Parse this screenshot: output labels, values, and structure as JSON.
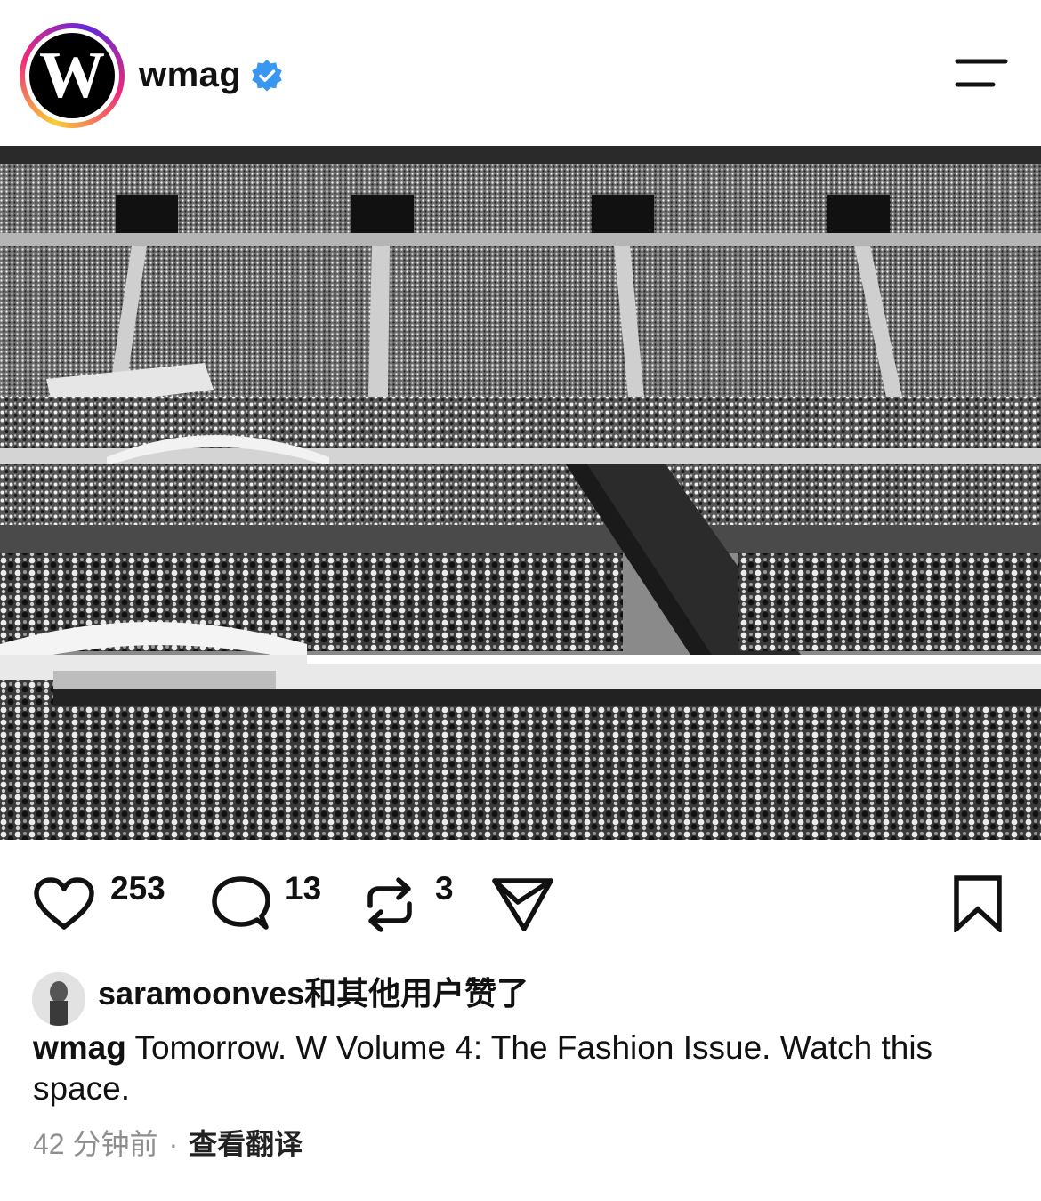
{
  "header": {
    "avatar_letter": "W",
    "username": "wmag",
    "verified_color": "#3897f0"
  },
  "post": {
    "image_alt": "Black and white photo of a packed stadium crowd with stage runways",
    "image_style": "black-and-white"
  },
  "actions": {
    "like_count": "253",
    "comment_count": "13",
    "repost_count": "3"
  },
  "likes": {
    "username": "saramoonves",
    "suffix": "和其他用户赞了"
  },
  "caption": {
    "username": "wmag",
    "text": " Tomorrow. W Volume 4: The Fashion Issue. Watch this space."
  },
  "meta": {
    "time": "42 分钟前",
    "separator": "·",
    "translate_label": "查看翻译"
  },
  "icons": [
    "menu-icon",
    "verified-badge-icon",
    "heart-icon",
    "comment-icon",
    "repost-icon",
    "share-icon",
    "bookmark-icon"
  ]
}
